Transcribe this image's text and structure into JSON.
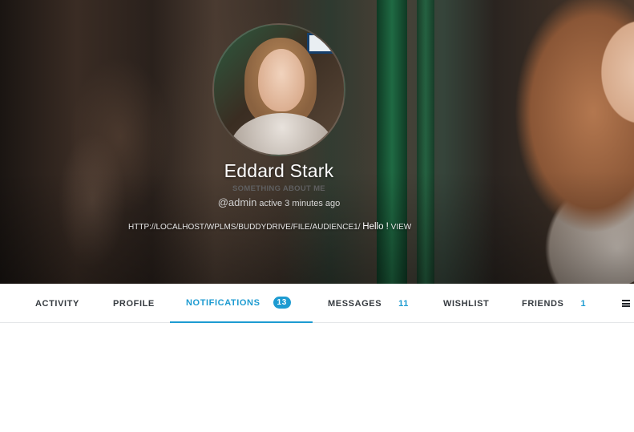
{
  "profile": {
    "name": "Eddard Stark",
    "about": "SOMETHING ABOUT ME",
    "handle": "@admin",
    "status": "active 3 minutes ago",
    "last_activity_url": "HTTP://LOCALHOST/WPLMS/BUDDYDRIVE/FILE/AUDIENCE1/",
    "last_activity_text": "Hello !",
    "view_label": "VIEW"
  },
  "nav": {
    "items": [
      {
        "label": "ACTIVITY"
      },
      {
        "label": "PROFILE"
      },
      {
        "label": "NOTIFICATIONS",
        "badge": "13"
      },
      {
        "label": "MESSAGES",
        "count": "11"
      },
      {
        "label": "WISHLIST"
      },
      {
        "label": "FRIENDS",
        "count": "1"
      }
    ]
  },
  "colors": {
    "accent": "#1d9bd1",
    "nav_text": "#363b40"
  },
  "icons": {
    "menu": "hamburger-menu-icon"
  }
}
